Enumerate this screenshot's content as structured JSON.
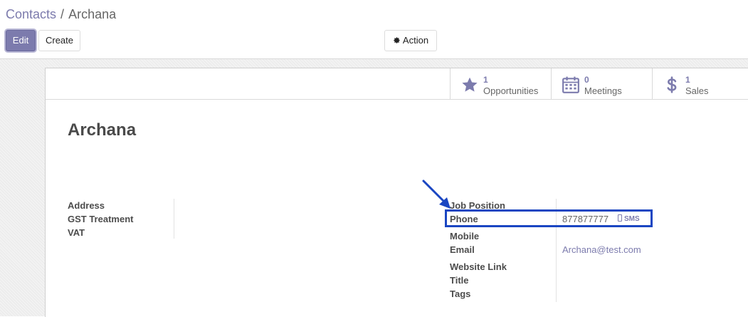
{
  "breadcrumb": {
    "parent": "Contacts",
    "separator": "/",
    "current": "Archana"
  },
  "toolbar": {
    "edit_label": "Edit",
    "create_label": "Create",
    "action_label": "Action"
  },
  "smart_buttons": [
    {
      "count": "1",
      "label": "Opportunities",
      "icon": "star-icon"
    },
    {
      "count": "0",
      "label": "Meetings",
      "icon": "calendar-icon"
    },
    {
      "count": "1",
      "label": "Sales",
      "icon": "dollar-icon"
    }
  ],
  "record": {
    "name": "Archana"
  },
  "left_fields": {
    "address": "Address",
    "gst_treatment": "GST Treatment",
    "vat": "VAT"
  },
  "right_fields": {
    "job_position": "Job Position",
    "phone": "Phone",
    "phone_value": "877877777",
    "sms_label": "SMS",
    "mobile": "Mobile",
    "email": "Email",
    "email_value": "Archana@test.com",
    "website": "Website Link",
    "title": "Title",
    "tags": "Tags"
  },
  "colors": {
    "accent": "#7c7bad",
    "annotation": "#1a46c2"
  }
}
